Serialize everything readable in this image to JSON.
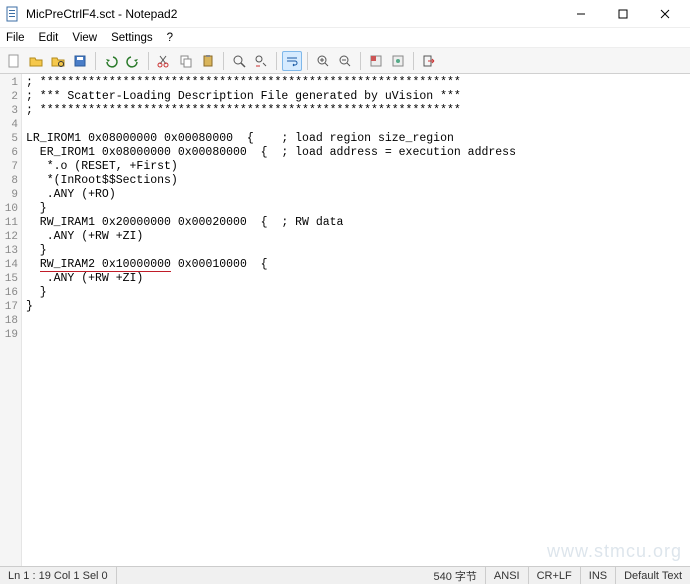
{
  "title": "MicPreCtrlF4.sct - Notepad2",
  "menu": {
    "file": "File",
    "edit": "Edit",
    "view": "View",
    "settings": "Settings",
    "help": "?"
  },
  "lines": [
    "; *************************************************************",
    "; *** Scatter-Loading Description File generated by uVision ***",
    "; *************************************************************",
    "",
    "LR_IROM1 0x08000000 0x00080000  {    ; load region size_region",
    "  ER_IROM1 0x08000000 0x00080000  {  ; load address = execution address",
    "   *.o (RESET, +First)",
    "   *(InRoot$$Sections)",
    "   .ANY (+RO)",
    "  }",
    "  RW_IRAM1 0x20000000 0x00020000  {  ; RW data",
    "   .ANY (+RW +ZI)",
    "  }",
    "  RW_IRAM2 0x10000000 0x00010000  {",
    "   .ANY (+RW +ZI)",
    "  }",
    "}",
    "",
    ""
  ],
  "line_numbers": [
    "1",
    "2",
    "3",
    "4",
    "5",
    "6",
    "7",
    "8",
    "9",
    "10",
    "11",
    "12",
    "13",
    "14",
    "15",
    "16",
    "17",
    "18",
    "19"
  ],
  "underline_line_index": 13,
  "underline_text": "RW_IRAM2 0x10000000",
  "status": {
    "pos": "Ln 1 : 19  Col 1  Sel 0",
    "bytes": "540 字节",
    "encoding": "ANSI",
    "eol": "CR+LF",
    "ins": "INS",
    "lexer": "Default Text"
  },
  "watermark": "www.stmcu.org"
}
